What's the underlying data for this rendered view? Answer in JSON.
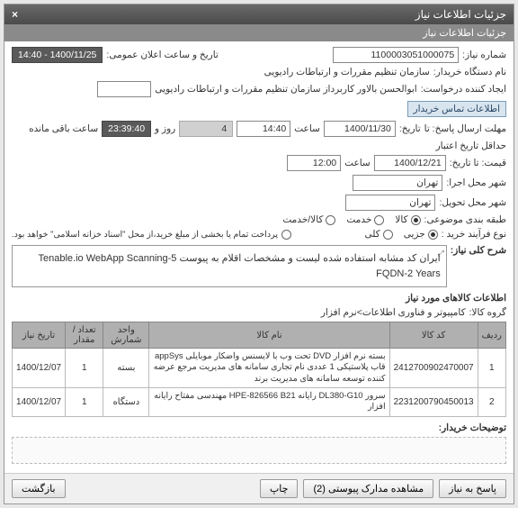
{
  "window": {
    "title": "جزئیات اطلاعات نیاز"
  },
  "section1": {
    "title": "جزئیات اطلاعات نیاز"
  },
  "labels": {
    "need_no": "شماره نیاز:",
    "pub_date": "تاریخ و ساعت اعلان عمومی:",
    "buyer": "نام دستگاه خریدار:",
    "requester": "ایجاد کننده درخواست:",
    "contact": "اطلاعات تماس خریدار",
    "deadline": "مهلت ارسال پاسخ: تا",
    "clock": "ساعت",
    "day_and": "روز و",
    "remain": "ساعت باقی مانده",
    "valid_min": "حداقل تاریخ اعتبار",
    "price_until": "قیمت: تا تاریخ:",
    "exec_city": "شهر محل اجرا:",
    "deliver_city": "شهر محل تحویل:",
    "grouping": "طبقه بندی موضوعی:",
    "buy_type": "نوع فرآیند خرید :",
    "partial_pay": "پرداخت تمام یا بخشی از مبلغ خرید،از محل \"اسناد خزانه اسلامی\" خواهد بود.",
    "main_desc": "شرح کلی نیاز:",
    "goods_info": "اطلاعات کالاهای مورد نیاز",
    "goods_group": "گروه کالا:",
    "buyer_remarks": "توضیحات خریدار:"
  },
  "values": {
    "need_no": "1100003051000075",
    "pub_date": "1400/11/25 - 14:40",
    "buyer": "سازمان تنظیم مقررات و ارتباطات رادیویی",
    "requester": "ابوالحسن بالاور کاربرداز سازمان تنظیم مقررات و ارتباطات رادیویی",
    "deadline_date": "1400/11/30",
    "deadline_time": "14:40",
    "days": "4",
    "remain_time": "23:39:40",
    "valid_date": "1400/12/21",
    "valid_time": "12:00",
    "exec_city": "تهران",
    "deliver_city": "تهران",
    "main_desc": "ایران کد مشابه استفاده شده لیست و مشخصات اقلام به پیوست Tenable.io WebApp Scanning-5 FQDN-2 Years",
    "goods_group": "کامپیوتر و فناوری اطلاعات>نرم افزار"
  },
  "radios": {
    "grouping": [
      {
        "label": "کالا",
        "selected": true
      },
      {
        "label": "خدمت",
        "selected": false
      },
      {
        "label": "کالا/خدمت",
        "selected": false
      }
    ],
    "buy_type": [
      {
        "label": "جزیی",
        "selected": true
      },
      {
        "label": "کلی",
        "selected": false
      }
    ]
  },
  "table": {
    "headers": [
      "ردیف",
      "کد کالا",
      "نام کالا",
      "واحد شمارش",
      "تعداد / مقدار",
      "تاریخ نیاز"
    ],
    "rows": [
      {
        "idx": "1",
        "code": "2412700902470007",
        "name": "بسته نرم افزار DVD تحت وب با لایسنس واضکار موبایلی appSys قاب پلاستیکی 1 عددی نام تجاری سامانه های مدیریت مرجع عرضه کننده توسعه سامانه های مدیریت برند",
        "unit": "بسته",
        "qty": "1",
        "date": "1400/12/07"
      },
      {
        "idx": "2",
        "code": "2231200790450013",
        "name": "سرور DL380-G10 رایانه HPE-826566 B21 مهندسی مفتاح رایانه افزار",
        "unit": "دستگاه",
        "qty": "1",
        "date": "1400/12/07"
      }
    ]
  },
  "buttons": {
    "reply": "پاسخ به نیاز",
    "attachments": "مشاهده مدارک پیوستی (2)",
    "print": "چاپ",
    "close": "بازگشت"
  }
}
